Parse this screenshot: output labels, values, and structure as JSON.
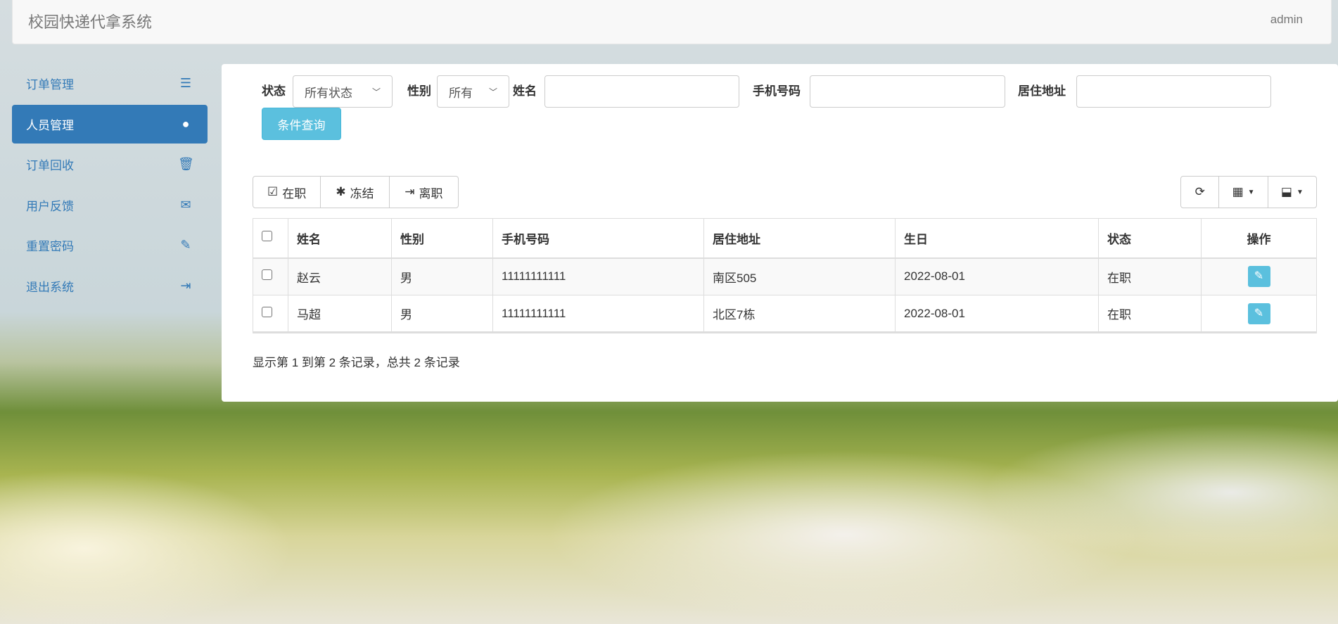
{
  "header": {
    "title": "校园快递代拿系统",
    "user": "admin"
  },
  "sidebar": {
    "items": [
      {
        "label": "订单管理",
        "icon": "server-icon",
        "glyph": "☰"
      },
      {
        "label": "人员管理",
        "icon": "user-icon",
        "glyph": "👤"
      },
      {
        "label": "订单回收",
        "icon": "trash-icon",
        "glyph": "🗑"
      },
      {
        "label": "用户反馈",
        "icon": "envelope-icon",
        "glyph": "✉"
      },
      {
        "label": "重置密码",
        "icon": "pencil-icon",
        "glyph": "✎"
      },
      {
        "label": "退出系统",
        "icon": "logout-icon",
        "glyph": "⇥"
      }
    ]
  },
  "filters": {
    "status_label": "状态",
    "status_value": "所有状态",
    "gender_label": "性别",
    "gender_value": "所有",
    "name_label": "姓名",
    "name_value": "",
    "phone_label": "手机号码",
    "phone_value": "",
    "address_label": "居住地址",
    "address_value": "",
    "query_button": "条件查询"
  },
  "toolbar": {
    "active": "在职",
    "freeze": "冻结",
    "leave": "离职"
  },
  "table": {
    "columns": [
      "姓名",
      "性别",
      "手机号码",
      "居住地址",
      "生日",
      "状态",
      "操作"
    ],
    "rows": [
      [
        "赵云",
        "男",
        "11111111111",
        "南区505",
        "2022-08-01",
        "在职"
      ],
      [
        "马超",
        "男",
        "11111111111",
        "北区7栋",
        "2022-08-01",
        "在职"
      ]
    ]
  },
  "footer": "显示第 1 到第 2 条记录，总共 2 条记录",
  "colors": {
    "primary": "#337ab7",
    "info": "#5bc0de"
  }
}
